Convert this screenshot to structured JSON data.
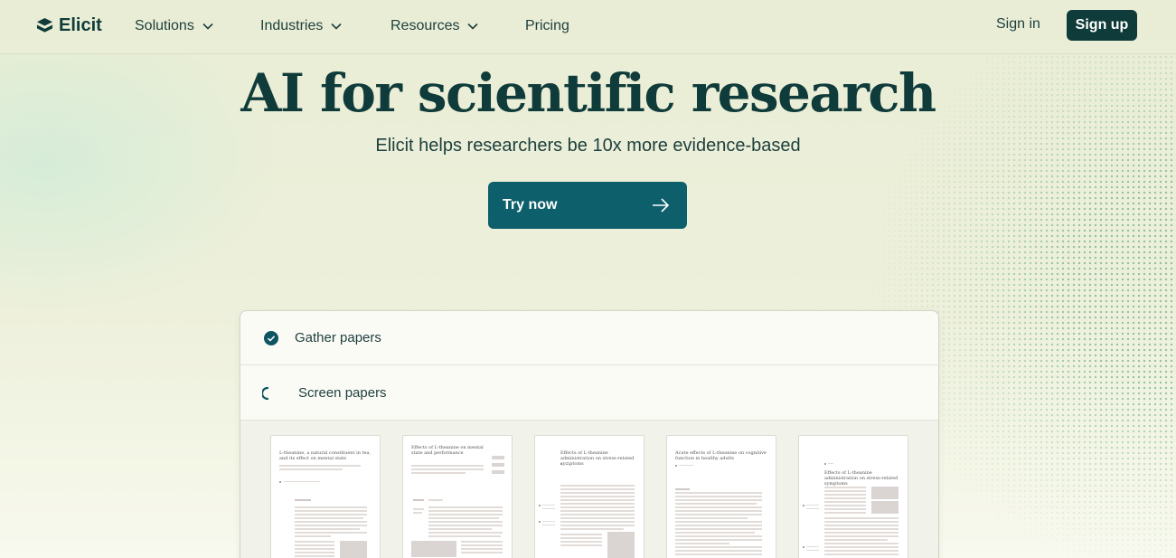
{
  "brand": {
    "name": "Elicit"
  },
  "nav": {
    "items": [
      {
        "label": "Solutions",
        "has_dropdown": true
      },
      {
        "label": "Industries",
        "has_dropdown": true
      },
      {
        "label": "Resources",
        "has_dropdown": true
      },
      {
        "label": "Pricing",
        "has_dropdown": false
      }
    ],
    "sign_in": "Sign in",
    "sign_up": "Sign up"
  },
  "hero": {
    "title": "AI for scientific research",
    "subtitle": "Elicit helps researchers be 10x more evidence-based",
    "cta": "Try now"
  },
  "workflow": {
    "steps": [
      {
        "label": "Gather papers",
        "status": "complete",
        "icon": "check-circle-icon"
      },
      {
        "label": "Screen papers",
        "status": "in-progress",
        "icon": "spinner-icon"
      }
    ],
    "papers": [
      {
        "title": "L-theanine, a natural constituent in tea, and its effect on mental state"
      },
      {
        "title": "Effects of L-theanine on mental state and performance"
      },
      {
        "title": "Effects of L-theanine administration on stress-related symptoms"
      },
      {
        "title": "Acute effects of L-theanine on cognitive function in healthy adults"
      },
      {
        "title": "Effects of L-theanine administration on stress-related symptoms"
      }
    ]
  },
  "colors": {
    "brand_dark": "#0f3b3a",
    "cta_teal": "#0d5f6b",
    "background": "#edf0db",
    "speckle_green": "#3d966e"
  }
}
